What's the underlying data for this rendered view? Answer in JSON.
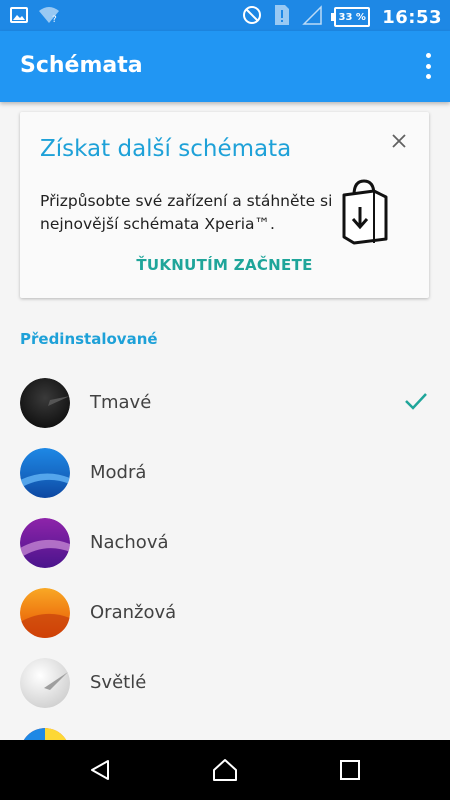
{
  "status_bar": {
    "battery_percent": "33 %",
    "time": "16:53",
    "icons": [
      "image-icon",
      "wifi-unknown-icon",
      "do-not-disturb-icon",
      "sim-alert-icon",
      "signal-icon",
      "battery-icon"
    ]
  },
  "app_bar": {
    "title": "Schémata",
    "overflow_icon": "more-vert-icon"
  },
  "promo_card": {
    "title": "Získat další schémata",
    "body": "Přizpůsobte své zařízení a stáhněte si nejnovější schémata Xperia™.",
    "cta": "ŤUKNUTÍM ZAČNETE",
    "close_icon": "close-icon",
    "illustration": "shopping-bag-download-icon"
  },
  "section_title": "Předinstalované",
  "themes": [
    {
      "label": "Tmavé",
      "selected": true
    },
    {
      "label": "Modrá",
      "selected": false
    },
    {
      "label": "Nachová",
      "selected": false
    },
    {
      "label": "Oranžová",
      "selected": false
    },
    {
      "label": "Světlé",
      "selected": false
    }
  ],
  "colors": {
    "status_bar": "#1e88e5",
    "app_bar": "#2196f3",
    "accent": "#1ea1d8",
    "cta": "#1fa59a"
  },
  "nav_bar": [
    "back-icon",
    "home-icon",
    "recents-icon"
  ]
}
